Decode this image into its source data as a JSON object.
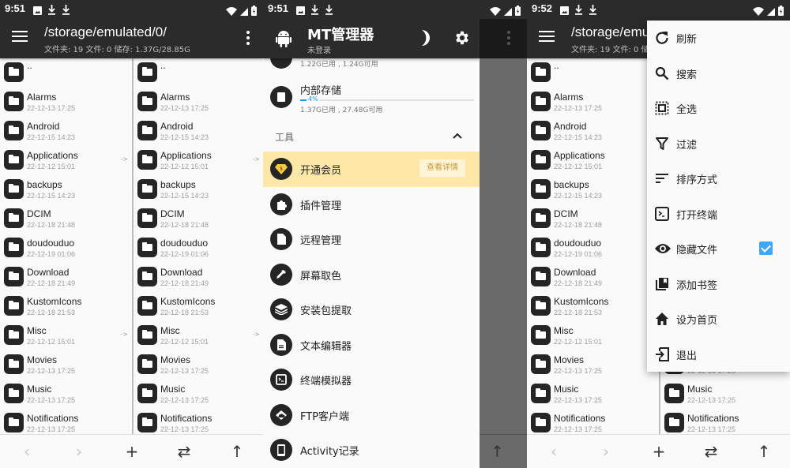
{
  "status_bar": {
    "time_1": "9:51",
    "time_2": "9:51",
    "time_3": "9:52",
    "icons": [
      "image-icon",
      "download-icon",
      "download-icon",
      "wifi-icon",
      "signal-icon",
      "battery-charging-icon"
    ]
  },
  "file_browser": {
    "path": "/storage/emulated/0/",
    "path_truncated": "/storage/emu",
    "summary": "文件夹: 19  文件: 0  储存: 1.37G/28.85G",
    "parent_label": "..",
    "link_marker": "->",
    "entries": [
      {
        "name": "Alarms",
        "date": "22-12-13 17:25",
        "link": false
      },
      {
        "name": "Android",
        "date": "22-12-15 14:23",
        "link": false
      },
      {
        "name": "Applications",
        "date": "22-12-12 15:01",
        "link": true
      },
      {
        "name": "backups",
        "date": "22-12-15 14:23",
        "link": false
      },
      {
        "name": "DCIM",
        "date": "22-12-18 21:48",
        "link": false
      },
      {
        "name": "doudouduo",
        "date": "22-12-19 01:06",
        "link": false
      },
      {
        "name": "Download",
        "date": "22-12-18 21:49",
        "link": false
      },
      {
        "name": "KustomIcons",
        "date": "22-12-18 21:53",
        "link": false
      },
      {
        "name": "Misc",
        "date": "22-12-12 15:01",
        "link": true
      },
      {
        "name": "Movies",
        "date": "22-12-13 17:25",
        "link": false
      },
      {
        "name": "Music",
        "date": "22-12-13 17:25",
        "link": false
      },
      {
        "name": "Notifications",
        "date": "22-12-13 17:25",
        "link": false
      }
    ],
    "bottom_bar": {
      "back": "‹",
      "forward": "›",
      "add": "+",
      "swap": "⇄",
      "up": "↑"
    }
  },
  "drawer": {
    "app_title": "MT管理器",
    "login_status": "未登录",
    "prev_storage_usage": "1.22G已用 , 1.24G可用",
    "storage": {
      "name": "内部存储",
      "percent_label": "4%",
      "percent": 4,
      "usage": "1.37G已用 , 27.48G可用"
    },
    "tools_section": "工具",
    "tools": [
      {
        "label": "开通会员",
        "icon": "vip-diamond-icon",
        "highlight": true,
        "action": "查看详情"
      },
      {
        "label": "插件管理",
        "icon": "puzzle-icon"
      },
      {
        "label": "远程管理",
        "icon": "document-icon"
      },
      {
        "label": "屏幕取色",
        "icon": "eyedropper-icon"
      },
      {
        "label": "安装包提取",
        "icon": "layers-icon"
      },
      {
        "label": "文本编辑器",
        "icon": "text-file-icon"
      },
      {
        "label": "终端模拟器",
        "icon": "terminal-icon"
      },
      {
        "label": "FTP客户端",
        "icon": "cloud-icon"
      },
      {
        "label": "Activity记录",
        "icon": "phone-icon"
      }
    ]
  },
  "popup_menu": {
    "items": [
      {
        "label": "刷新",
        "icon": "refresh-icon"
      },
      {
        "label": "搜索",
        "icon": "search-icon"
      },
      {
        "label": "全选",
        "icon": "select-all-icon"
      },
      {
        "label": "过滤",
        "icon": "filter-icon"
      },
      {
        "label": "排序方式",
        "icon": "sort-icon"
      },
      {
        "label": "打开终端",
        "icon": "terminal-icon"
      },
      {
        "label": "隐藏文件",
        "icon": "eye-icon",
        "checked": true
      },
      {
        "label": "添加书签",
        "icon": "bookmark-icon"
      },
      {
        "label": "设为首页",
        "icon": "home-icon"
      },
      {
        "label": "退出",
        "icon": "exit-icon"
      }
    ]
  },
  "colors": {
    "toolbar": "#2b2b2b",
    "accent_blue": "#2196f3",
    "vip_highlight": "#ffe7a8",
    "vip_button_text": "#c79a3a"
  }
}
